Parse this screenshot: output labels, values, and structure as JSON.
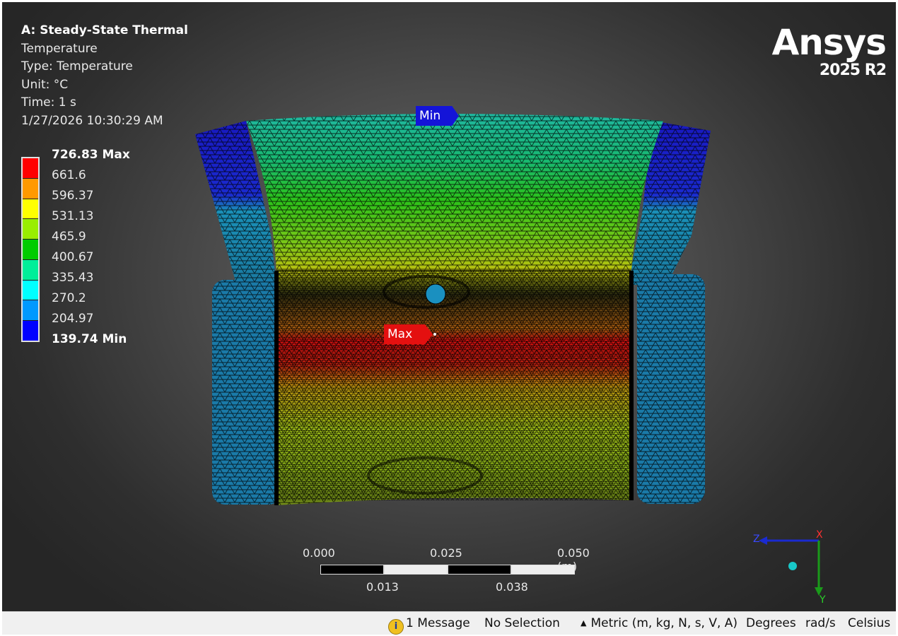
{
  "info": {
    "title": "A: Steady-State Thermal",
    "result_name": "Temperature",
    "type": "Type: Temperature",
    "unit": "Unit: °C",
    "time": "Time: 1 s",
    "timestamp": "1/27/2026 10:30:29 AM"
  },
  "legend": {
    "labels": [
      "726.83 Max",
      "661.6",
      "596.37",
      "531.13",
      "465.9",
      "400.67",
      "335.43",
      "270.2",
      "204.97",
      "139.74 Min"
    ],
    "colors": [
      "#ff0000",
      "#ff9900",
      "#ffff00",
      "#99ee00",
      "#00cc00",
      "#00ee99",
      "#00ffff",
      "#0099ff",
      "#0000ff"
    ]
  },
  "logo": {
    "brand": "Ansys",
    "version": "2025 R2"
  },
  "probes": {
    "min_label": "Min",
    "max_label": "Max"
  },
  "scale": {
    "top_labels": [
      "0.000",
      "0.025",
      "0.050 (m)"
    ],
    "bottom_labels": [
      "0.013",
      "0.038"
    ]
  },
  "triad": {
    "x_label": "X",
    "y_label": "Y",
    "z_label": "Z"
  },
  "statusbar": {
    "messages": "1 Message",
    "selection": "No Selection",
    "units": "Metric (m, kg, N, s, V, A)",
    "angle": "Degrees",
    "rotational_velocity": "rad/s",
    "temperature": "Celsius"
  }
}
